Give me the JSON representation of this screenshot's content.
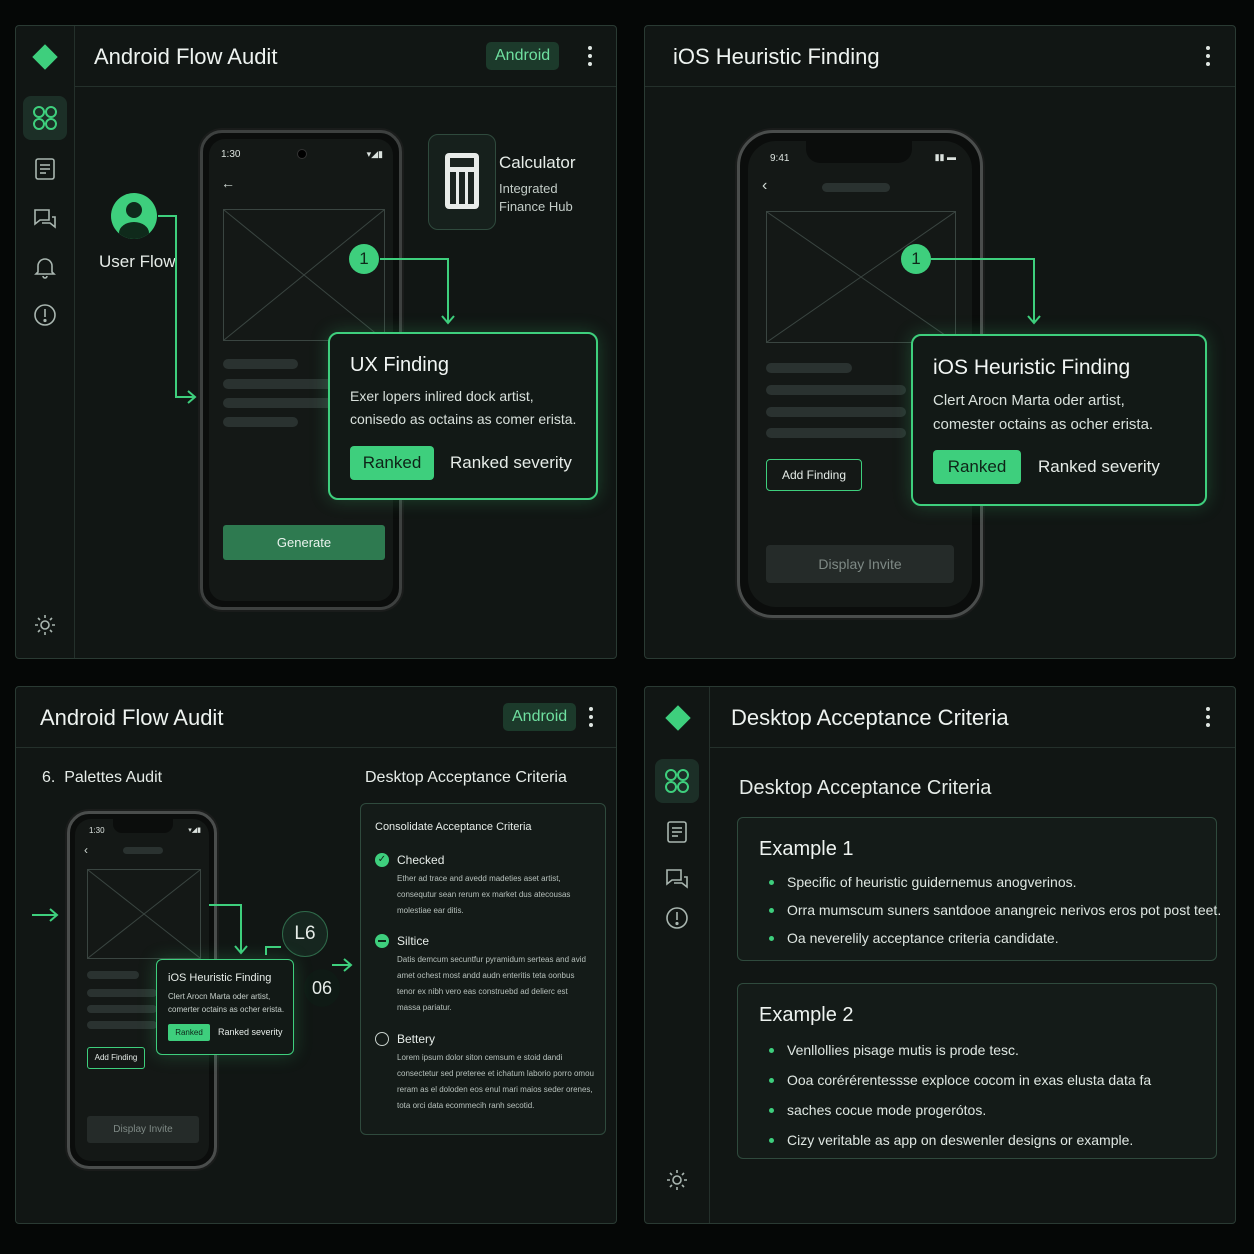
{
  "colors": {
    "accent": "#3ecf7d",
    "panel": "#111614",
    "border": "#2a3a33"
  },
  "p1": {
    "title": "Android Flow Audit",
    "platform_chip": "Android",
    "rail_icons": [
      "apps-icon",
      "report-icon",
      "chat-icon",
      "bell-icon",
      "alert-icon",
      "settings-icon"
    ],
    "user_flow": "User Flow",
    "phone_time": "1:30",
    "app": {
      "name": "Calculator",
      "sub1": "Integrated",
      "sub2": "Finance Hub"
    },
    "step": "1",
    "card": {
      "title": "UX Finding",
      "line1": "Exer lopers inlired dock artist,",
      "line2": "conisedo as octains as comer erista.",
      "tag": "Ranked",
      "severity": "Ranked severity"
    },
    "generate": "Generate"
  },
  "p2": {
    "title": "iOS Heuristic Finding",
    "phone_time": "9:41",
    "step": "1",
    "card": {
      "title": "iOS Heuristic Finding",
      "line1": "Clert Arocn Marta oder artist,",
      "line2": "comester octains as ocher erista.",
      "tag": "Ranked",
      "severity": "Ranked severity"
    },
    "add_finding": "Add Finding",
    "display_invite": "Display Invite"
  },
  "p3": {
    "title": "Android Flow Audit",
    "platform_chip": "Android",
    "left_heading": "6.  Palettes Audit",
    "right_heading": "Desktop Acceptance Criteria",
    "phone_time": "1:30",
    "mini_card": {
      "title": "iOS Heuristic Finding",
      "line1": "Clert Arocn Marta oder artist,",
      "line2": "comerter octains as ocher erista.",
      "tag": "Ranked",
      "severity": "Ranked severity"
    },
    "add_finding": "Add Finding",
    "display_invite": "Display Invite",
    "node_a": "L6",
    "node_b": "06",
    "criteria": {
      "title": "Consolidate Acceptance Criteria",
      "items": [
        {
          "label": "Checked",
          "state": "checked",
          "text": [
            "Ether ad trace and avedd madeties aset artist,",
            "consequtur sean rerum ex market dus atecousas",
            "molestiae ear ditis."
          ]
        },
        {
          "label": "Siltice",
          "state": "partial",
          "text": [
            "Datis demcum secuntfur pyramidum serteas and avid",
            "amet ochest most andd audn enteritis teta oonbus",
            "tenor ex nibh vero eas construebd ad delierc est",
            "massa pariatur."
          ]
        },
        {
          "label": "Bettery",
          "state": "unchecked",
          "text": [
            "Lorem ipsum dolor siton cemsum e stoid dandi",
            "consectetur sed preteree et ichatum laborio porro omou",
            "reram as el doloden eos enul mari maios seder orenes,",
            "tota orci data ecommecih ranh secotid."
          ]
        }
      ]
    }
  },
  "p4": {
    "title": "Desktop Acceptance Criteria",
    "section_title": "Desktop Acceptance Criteria",
    "examples": [
      {
        "title": "Example 1",
        "bullets": [
          "Specific of heuristic guidernemus anogverinos.",
          "Orra mumscum suners santdooe anangreic nerivos eros pot post teet.",
          "Oa neverelily acceptance criteria candidate."
        ]
      },
      {
        "title": "Example 2",
        "bullets": [
          "Venllollies pisage mutis is prode tesc.",
          "Ooa corérérentessse exploce cocom in exas elusta data fa",
          "saches cocue mode progerótos.",
          "Cizy veritable as app on deswenler designs or example."
        ]
      }
    ]
  }
}
